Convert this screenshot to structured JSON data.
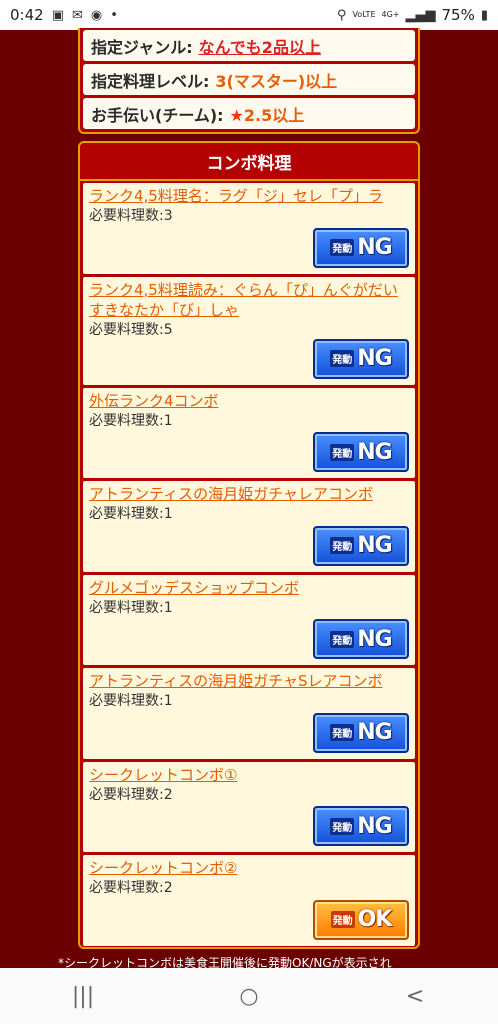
{
  "status_bar": {
    "time": "0:42",
    "battery": "75%",
    "network": "4G+",
    "volte": "VoLTE"
  },
  "criteria": [
    {
      "label": "指定ジャンル:",
      "value": "なんでも2品以上"
    },
    {
      "label": "指定料理レベル:",
      "value": "3(マスター)以上"
    },
    {
      "label": "お手伝い(チーム):",
      "star": "★",
      "value": "2.5以上"
    }
  ],
  "combo": {
    "title": "コンボ料理",
    "items": [
      {
        "name": "ランク4,5料理名：ラグ「ジ」セレ「プ」ラ",
        "count": "必要料理数:3",
        "status_small": "発動",
        "status": "NG"
      },
      {
        "name": "ランク4,5料理読み：ぐらん「ぴ」んぐがだいすきなたか「び」しゃ",
        "count": "必要料理数:5",
        "status_small": "発動",
        "status": "NG"
      },
      {
        "name": "外伝ランク4コンボ",
        "count": "必要料理数:1",
        "status_small": "発動",
        "status": "NG"
      },
      {
        "name": "アトランティスの海月姫ガチャレアコンボ",
        "count": "必要料理数:1",
        "status_small": "発動",
        "status": "NG"
      },
      {
        "name": "グルメゴッデスショップコンボ",
        "count": "必要料理数:1",
        "status_small": "発動",
        "status": "NG"
      },
      {
        "name": "アトランティスの海月姫ガチャSレアコンボ",
        "count": "必要料理数:1",
        "status_small": "発動",
        "status": "NG"
      },
      {
        "name": "シークレットコンボ①",
        "count": "必要料理数:2",
        "status_small": "発動",
        "status": "NG"
      },
      {
        "name": "シークレットコンボ②",
        "count": "必要料理数:2",
        "status_small": "発動",
        "status": "OK"
      }
    ]
  },
  "footnote": "*シークレットコンボは美食王開催後に発動OK/NGが表示され",
  "nav": {
    "recents": "|||",
    "home": "○",
    "back": "<"
  },
  "colors": {
    "background": "#6b0000",
    "panel": "#b30000",
    "accent_orange": "#e65c00",
    "ng_blue": "#1550d8",
    "ok_orange": "#ff7a00"
  }
}
